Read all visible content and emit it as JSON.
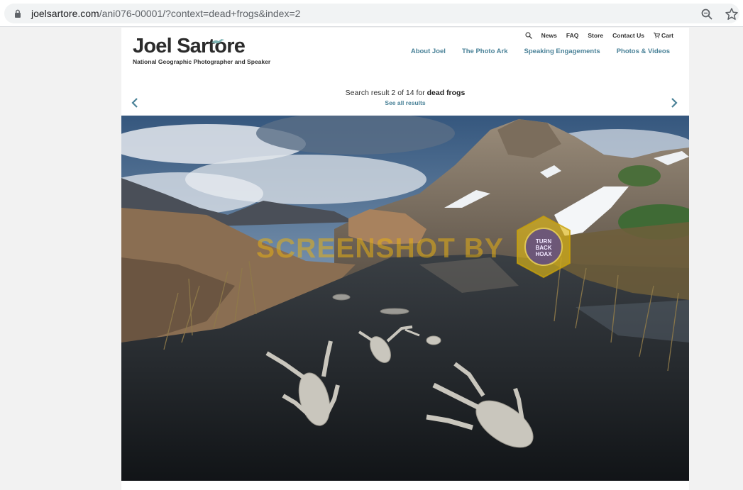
{
  "browser": {
    "url_domain": "joelsartore.com",
    "url_path": "/ani076-00001/?context=dead+frogs&index=2",
    "icons": [
      "lock-icon",
      "zoom-icon",
      "star-icon"
    ]
  },
  "site": {
    "logo_name": "Joel Sartore",
    "tagline": "National Geographic Photographer and Speaker",
    "util_nav": {
      "news": "News",
      "faq": "FAQ",
      "store": "Store",
      "contact": "Contact Us",
      "cart": "Cart"
    },
    "main_nav": {
      "about": "About Joel",
      "photo_ark": "The Photo Ark",
      "speaking": "Speaking Engagements",
      "photos_videos": "Photos & Videos"
    },
    "accent_color": "#4a8298"
  },
  "results": {
    "prefix": "Search result 2 of 14 for ",
    "query": "dead frogs",
    "see_all": "See all results"
  },
  "photo": {
    "watermark": "SCREENSHOT BY",
    "badge_text": [
      "TURN",
      "BACK",
      "HOAX"
    ]
  }
}
